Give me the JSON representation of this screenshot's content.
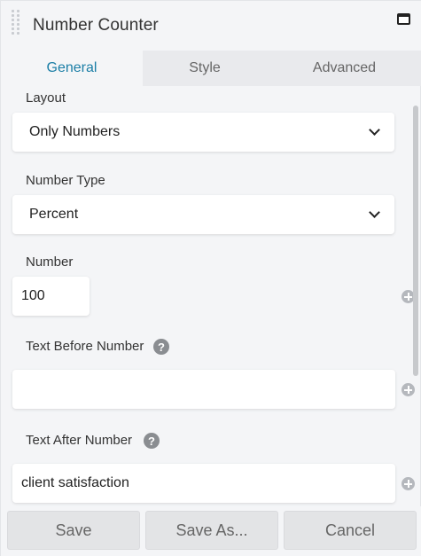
{
  "header": {
    "title": "Number Counter"
  },
  "tabs": [
    {
      "label": "General",
      "active": true
    },
    {
      "label": "Style",
      "active": false
    },
    {
      "label": "Advanced",
      "active": false
    }
  ],
  "fields": {
    "layout": {
      "label": "Layout",
      "value": "Only Numbers"
    },
    "number_type": {
      "label": "Number Type",
      "value": "Percent"
    },
    "number": {
      "label": "Number",
      "value": "100"
    },
    "text_before": {
      "label": "Text Before Number",
      "value": "",
      "help": "?"
    },
    "text_after": {
      "label": "Text After Number",
      "value": "client satisfaction",
      "help": "?"
    }
  },
  "footer": {
    "save": "Save",
    "save_as": "Save As...",
    "cancel": "Cancel"
  },
  "colors": {
    "accent": "#1b7ea6",
    "panel_bg": "#f4f5f7",
    "tab_inactive_bg": "#e9eaed",
    "button_bg": "#e3e4e6"
  },
  "icons": {
    "drag": "drag-handle-icon",
    "maximize": "maximize-icon",
    "chevron": "chevron-down-icon",
    "help": "help-icon",
    "add": "plus-circle-icon"
  }
}
